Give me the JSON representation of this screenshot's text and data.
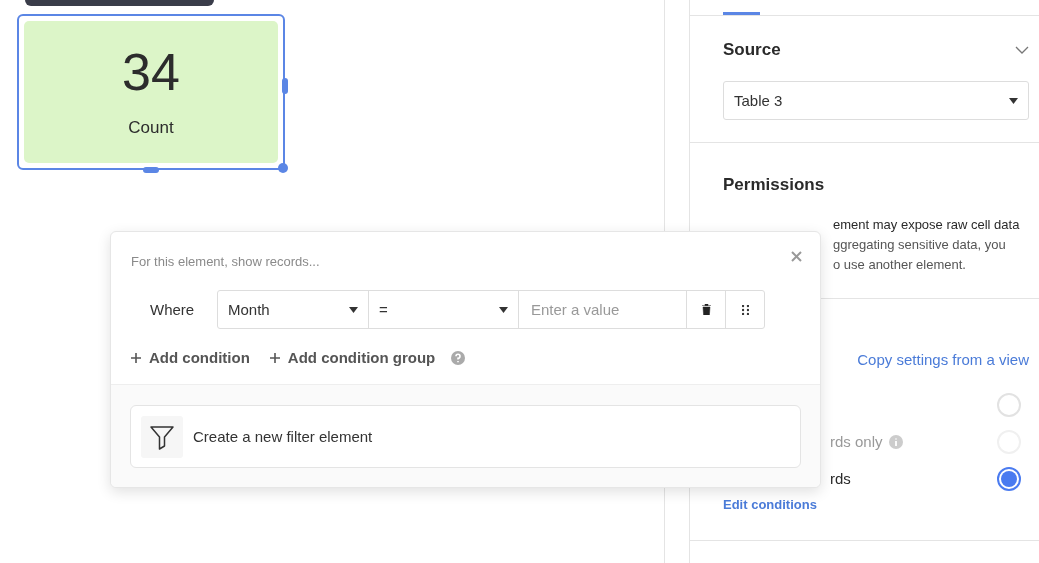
{
  "metric_card": {
    "value": "34",
    "label": "Count",
    "selected": true
  },
  "panel": {
    "source": {
      "title": "Source",
      "expanded": true,
      "table": "Table 3"
    },
    "permissions": {
      "title": "Permissions",
      "warning_title": "ement may expose raw cell data",
      "warning_lines": [
        "ggregating sensitive data, you",
        "o use another element."
      ]
    },
    "copy_link": "Copy settings from a view",
    "options": [
      {
        "selected": false
      },
      {
        "label": "rds only",
        "selected": false,
        "info": true,
        "disabled": true
      },
      {
        "label": "rds",
        "selected": true
      }
    ],
    "edit_link": "Edit conditions"
  },
  "filter_popup": {
    "hint": "For this element, show records...",
    "condition": {
      "prefix": "Where",
      "field": "Month",
      "operator": "=",
      "value_placeholder": "Enter a value"
    },
    "actions": [
      "Add condition",
      "Add condition group"
    ],
    "create_button": "Create a new filter element"
  }
}
